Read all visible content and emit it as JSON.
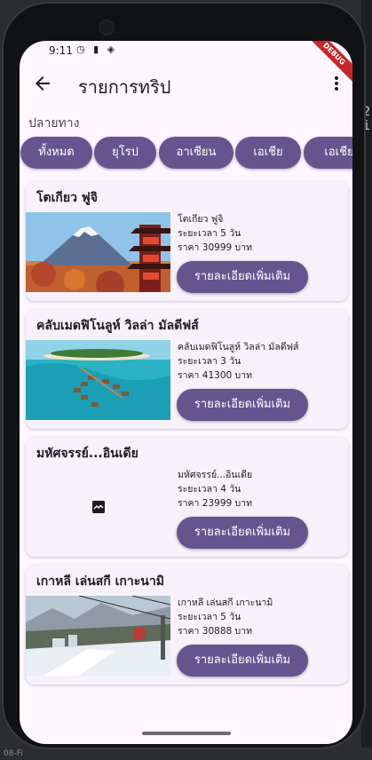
{
  "status_bar": {
    "time": "9:11"
  },
  "debug_banner": "DEBUG",
  "app_bar": {
    "title": "รายการทริป"
  },
  "filter": {
    "label": "ปลายทาง",
    "chips": [
      "ทั้งหมด",
      "ยุโรป",
      "อาเซียน",
      "เอเชีย",
      "เอเชีย"
    ]
  },
  "trips": [
    {
      "title": "โตเกียว ฟูจิ",
      "name": " โตเกียว ฟูจิ",
      "duration": "ระยะเวลา 5 วัน",
      "price": "ราคา 30999 บาท",
      "button": "รายละเอียดเพิ่มเติม",
      "image_icon": "mount-fuji-pagoda-image"
    },
    {
      "title": "คลับเมดฟิโนลูห์ วิลล่า มัลดีฟส์",
      "name": "คลับเมดฟิโนลูห์ วิลล่า มัลดีฟส์",
      "duration": "ระยะเวลา 3 วัน",
      "price": "ราคา 41300 บาท",
      "button": "รายละเอียดเพิ่มเติม",
      "image_icon": "maldives-water-villa-image"
    },
    {
      "title": "มหัศจรรย์...อินเดีย",
      "name": "มหัศจรรย์...อินเดีย",
      "duration": "ระยะเวลา 4 วัน",
      "price": "ราคา 23999 บาท",
      "button": "รายละเอียดเพิ่มเติม",
      "image_icon": "broken-image-icon"
    },
    {
      "title": "เกาหลี เล่นสกี เกาะนามิ",
      "name": "เกาหลี เล่นสกี เกาะนามิ",
      "duration": "ระยะเวลา 5 วัน",
      "price": "ราคา 30888 บาท",
      "button": "รายละเอียดเพิ่มเติม",
      "image_icon": "ski-resort-gondola-image"
    }
  ],
  "ide": {
    "side_text": "2\ni",
    "bottom_text": "08-Fi"
  }
}
